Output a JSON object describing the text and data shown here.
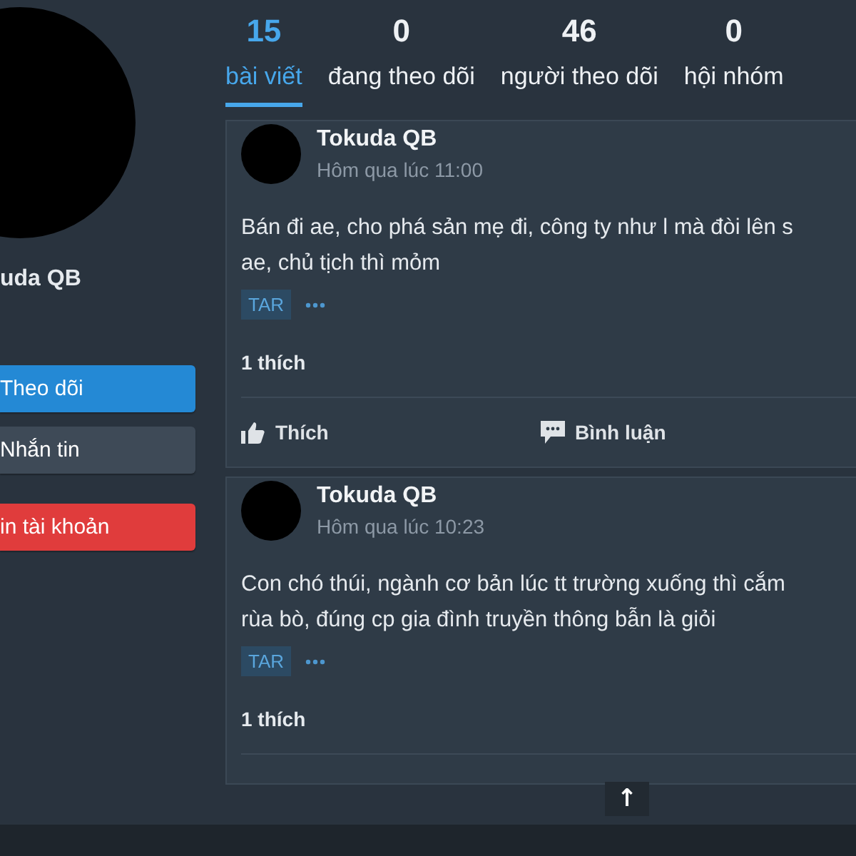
{
  "profile": {
    "name": "uda QB",
    "buttons": [
      {
        "label": "Theo dõi",
        "kind": "primary"
      },
      {
        "label": "Nhắn tin",
        "kind": "secondary"
      },
      {
        "label": "in tài khoản",
        "kind": "danger"
      }
    ]
  },
  "stats": [
    {
      "count": "15",
      "label": "bài viết",
      "selected": true
    },
    {
      "count": "0",
      "label": "đang theo dõi",
      "selected": false
    },
    {
      "count": "46",
      "label": "người theo dõi",
      "selected": false
    },
    {
      "count": "0",
      "label": "hội nhóm",
      "selected": false
    }
  ],
  "posts": [
    {
      "author": "Tokuda QB",
      "time": "Hôm qua lúc 11:00",
      "body_lines": [
        "Bán đi ae, cho phá sản mẹ đi, công ty như l mà đòi lên s",
        "ae, chủ tịch thì mỏm"
      ],
      "tag": "TAR",
      "likes": "1 thích",
      "actions": [
        {
          "label": "Thích",
          "kind": "like"
        },
        {
          "label": "Bình luận",
          "kind": "comment"
        }
      ]
    },
    {
      "author": "Tokuda QB",
      "time": "Hôm qua lúc 10:23",
      "body_lines": [
        "Con chó thúi, ngành cơ bản lúc tt trường xuống thì cắm",
        "rùa bò, đúng cp gia đình truyền thông bẫn là giỏi"
      ],
      "tag": "TAR",
      "likes": "1 thích"
    }
  ],
  "scroll_top": {
    "label": "↑"
  }
}
